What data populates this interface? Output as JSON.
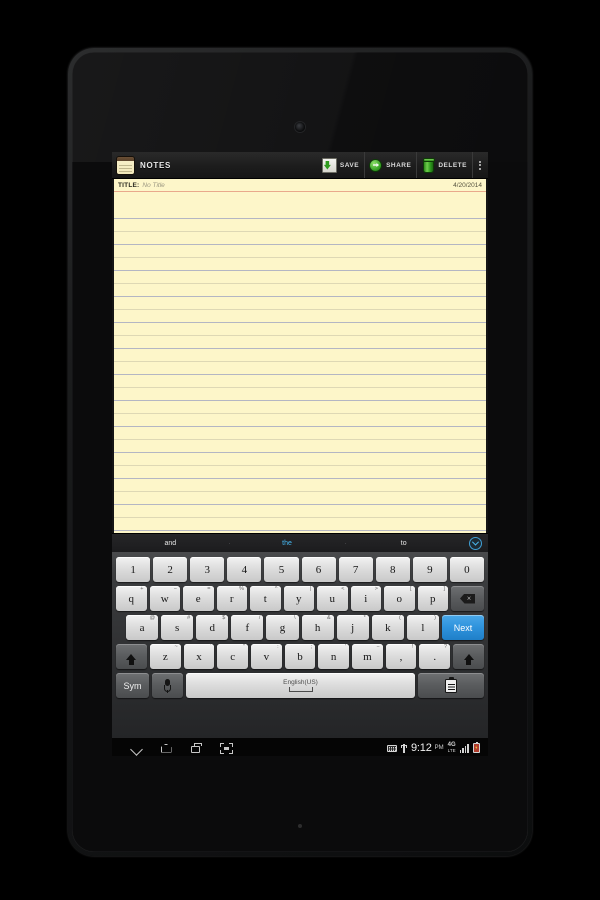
{
  "app": {
    "name": "NOTES",
    "icon": "notepad-icon"
  },
  "actionbar": {
    "save_label": "SAVE",
    "share_label": "SHARE",
    "delete_label": "DELETE",
    "overflow_label": "More options"
  },
  "note": {
    "title_label": "TITLE:",
    "title_value": "No Title",
    "date": "4/20/2014",
    "body_text": ""
  },
  "suggestions": {
    "items": [
      {
        "text": "and",
        "active": false
      },
      {
        "text": "the",
        "active": true
      },
      {
        "text": "to",
        "active": false
      }
    ],
    "expand_icon": "chevron-down-circle-icon"
  },
  "keyboard": {
    "language": "English(US)",
    "sym_label": "Sym",
    "enter_label": "Next",
    "mic_icon": "microphone-icon",
    "clipboard_icon": "clipboard-icon",
    "backspace_icon": "backspace-icon",
    "shift_icon": "shift-arrow-icon",
    "rows": {
      "numbers": [
        {
          "main": "1",
          "sup": ""
        },
        {
          "main": "2",
          "sup": ""
        },
        {
          "main": "3",
          "sup": ""
        },
        {
          "main": "4",
          "sup": ""
        },
        {
          "main": "5",
          "sup": ""
        },
        {
          "main": "6",
          "sup": ""
        },
        {
          "main": "7",
          "sup": ""
        },
        {
          "main": "8",
          "sup": ""
        },
        {
          "main": "9",
          "sup": ""
        },
        {
          "main": "0",
          "sup": ""
        }
      ],
      "top": [
        {
          "main": "q",
          "sup": "+"
        },
        {
          "main": "w",
          "sup": "−"
        },
        {
          "main": "e",
          "sup": "="
        },
        {
          "main": "r",
          "sup": "%"
        },
        {
          "main": "t",
          "sup": "^"
        },
        {
          "main": "y",
          "sup": "|"
        },
        {
          "main": "u",
          "sup": "<"
        },
        {
          "main": "i",
          "sup": ">"
        },
        {
          "main": "o",
          "sup": "["
        },
        {
          "main": "p",
          "sup": "]"
        }
      ],
      "home": [
        {
          "main": "a",
          "sup": "@"
        },
        {
          "main": "s",
          "sup": "#"
        },
        {
          "main": "d",
          "sup": "$"
        },
        {
          "main": "f",
          "sup": "/"
        },
        {
          "main": "g",
          "sup": "\\"
        },
        {
          "main": "h",
          "sup": "&"
        },
        {
          "main": "j",
          "sup": "*"
        },
        {
          "main": "k",
          "sup": "("
        },
        {
          "main": "l",
          "sup": ")"
        }
      ],
      "bottom": [
        {
          "main": "z",
          "sup": "~"
        },
        {
          "main": "x",
          "sup": "`"
        },
        {
          "main": "c",
          "sup": "”"
        },
        {
          "main": "v",
          "sup": ":"
        },
        {
          "main": "b",
          "sup": ";"
        },
        {
          "main": "n",
          "sup": "'"
        },
        {
          "main": "m",
          "sup": "−"
        },
        {
          "main": ",",
          "sup": "!"
        },
        {
          "main": ".",
          "sup": "?"
        }
      ]
    }
  },
  "navbar": {
    "back_icon": "chevron-down-icon",
    "home_icon": "home-icon",
    "recents_icon": "recents-icon",
    "screenshot_icon": "screenshot-icon"
  },
  "statusbar": {
    "keyboard_icon": "keyboard-indicator-icon",
    "usb_icon": "usb-icon",
    "time": "9:12",
    "ampm": "PM",
    "network_main": "4G",
    "network_sub": "LTE",
    "signal_icon": "signal-bars-icon",
    "battery_icon": "battery-charging-icon"
  },
  "device": {
    "camera": "front-camera",
    "bottom_sensor": "mic-dot"
  },
  "colors": {
    "paper": "#fdf6c9",
    "rule_line": "#7882be",
    "accent_blue": "#44b6f0",
    "accent_green": "#2f9b1e",
    "title_divider": "#e9a98c"
  }
}
